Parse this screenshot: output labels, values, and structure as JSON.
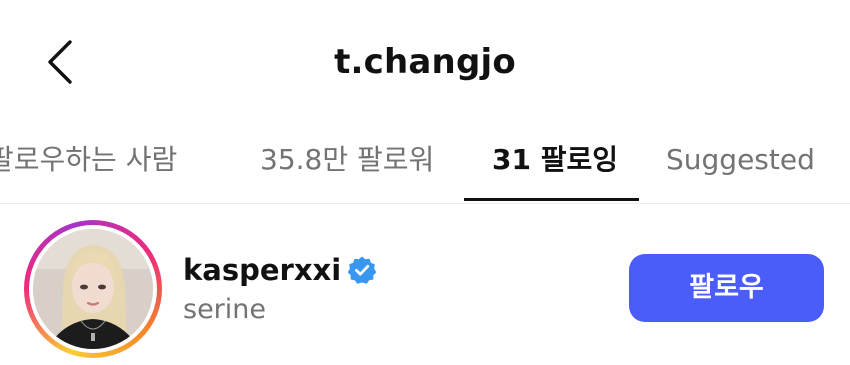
{
  "header": {
    "title": "t.changjo",
    "back_icon": "chevron-left-icon"
  },
  "tabs": [
    {
      "label": "팔로우하는 사람",
      "active": false
    },
    {
      "label": "35.8만 팔로워",
      "active": false
    },
    {
      "label": "31 팔로잉",
      "active": true
    },
    {
      "label": "Suggested",
      "active": false
    }
  ],
  "list": {
    "items": [
      {
        "username": "kasperxxi",
        "full_name": "serine",
        "verified": true,
        "verified_icon": "verified-badge-icon",
        "button_label": "팔로우",
        "avatar_icon": "profile-photo"
      }
    ]
  },
  "colors": {
    "follow_button": "#4a5df9",
    "verified_badge": "#3897f0",
    "secondary_text": "#737373",
    "active_indicator": "#111111"
  }
}
